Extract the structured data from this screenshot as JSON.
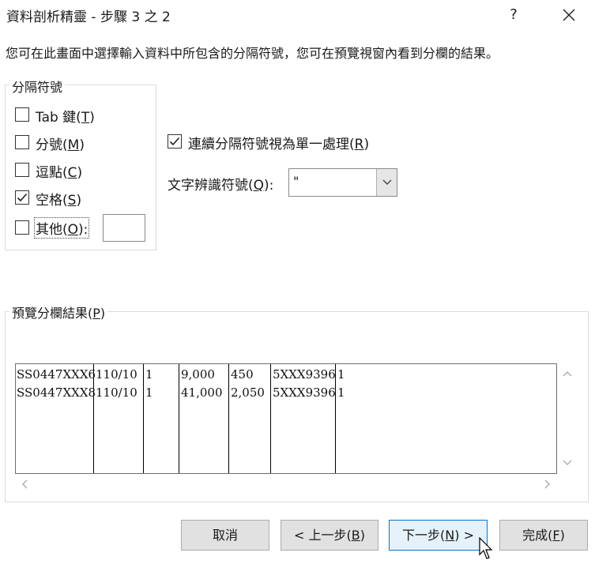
{
  "window": {
    "title": "資料剖析精靈 - 步驟 3 之 2",
    "help": "?"
  },
  "description": "您可在此畫面中選擇輸入資料中所包含的分隔符號，您可在預覽視窗內看到分欄的結果。",
  "delimiters": {
    "legend": "分隔符號",
    "items": [
      {
        "text": "Tab 鍵(",
        "key": "T",
        "end": ")",
        "checked": false
      },
      {
        "text": "分號(",
        "key": "M",
        "end": ")",
        "checked": false
      },
      {
        "text": "逗點(",
        "key": "C",
        "end": ")",
        "checked": false
      },
      {
        "text": "空格(",
        "key": "S",
        "end": ")",
        "checked": true
      },
      {
        "text": "其他(",
        "key": "O",
        "end": "):",
        "checked": false
      }
    ],
    "other_value": ""
  },
  "consecutive": {
    "text": "連續分隔符號視為單一處理(",
    "key": "R",
    "end": ")",
    "checked": true
  },
  "qualifier": {
    "text": "文字辨識符號(",
    "key": "Q",
    "end": "):",
    "value": "\""
  },
  "preview": {
    "legend_text": "預覽分欄結果(",
    "legend_key": "P",
    "legend_end": ")",
    "rows": [
      [
        "SS0447XXX6",
        "110/10",
        "1",
        "9,000",
        "450",
        "5XXX9396",
        "1"
      ],
      [
        "SS0447XXX8",
        "110/10",
        "1",
        "41,000",
        "2,050",
        "5XXX9396",
        "1"
      ]
    ]
  },
  "buttons": {
    "cancel": "取消",
    "back_text": "< 上一步(",
    "back_key": "B",
    "back_end": ")",
    "next_text": "下一步(",
    "next_key": "N",
    "next_end": ") >",
    "finish_text": "完成(",
    "finish_key": "F",
    "finish_end": ")"
  }
}
